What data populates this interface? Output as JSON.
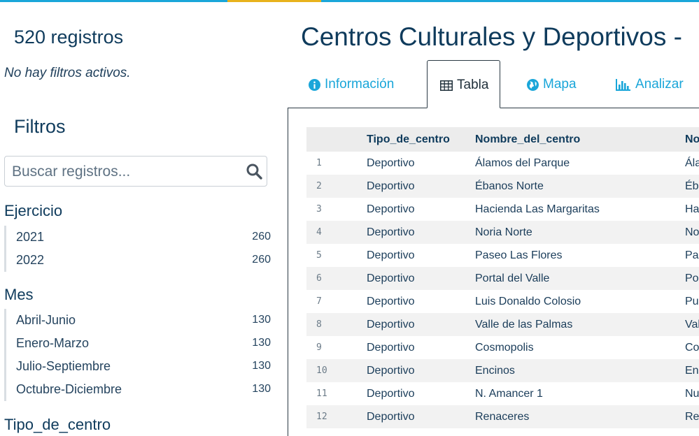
{
  "sidebar": {
    "record_count": "520 registros",
    "no_filters": "No hay filtros activos.",
    "filters_title": "Filtros",
    "search_placeholder": "Buscar registros...",
    "facets": [
      {
        "title": "Ejercicio",
        "items": [
          {
            "label": "2021",
            "count": "260"
          },
          {
            "label": "2022",
            "count": "260"
          }
        ]
      },
      {
        "title": "Mes",
        "items": [
          {
            "label": "Abril-Junio",
            "count": "130"
          },
          {
            "label": "Enero-Marzo",
            "count": "130"
          },
          {
            "label": "Julio-Septiembre",
            "count": "130"
          },
          {
            "label": "Octubre-Diciembre",
            "count": "130"
          }
        ]
      },
      {
        "title": "Tipo_de_centro",
        "items": []
      }
    ]
  },
  "main": {
    "title": "Centros Culturales y Deportivos - ",
    "tabs": [
      {
        "label": "Información",
        "icon": "info-circle-icon"
      },
      {
        "label": "Tabla",
        "icon": "table-icon"
      },
      {
        "label": "Mapa",
        "icon": "globe-icon"
      },
      {
        "label": "Analizar",
        "icon": "bar-chart-icon"
      }
    ],
    "active_tab": "Tabla",
    "table": {
      "headers": [
        "",
        "Tipo_de_centro",
        "Nombre_del_centro",
        "No"
      ],
      "rows": [
        [
          "1",
          "Deportivo",
          "Álamos del Parque",
          "Ála"
        ],
        [
          "2",
          "Deportivo",
          "Ébanos Norte",
          "Éba"
        ],
        [
          "3",
          "Deportivo",
          "Hacienda Las Margaritas",
          "Ha"
        ],
        [
          "4",
          "Deportivo",
          "Noria Norte",
          "No"
        ],
        [
          "5",
          "Deportivo",
          "Paseo Las Flores",
          "Pas"
        ],
        [
          "6",
          "Deportivo",
          "Portal del Valle",
          "Por"
        ],
        [
          "7",
          "Deportivo",
          "Luis Donaldo Colosio",
          "Pue"
        ],
        [
          "8",
          "Deportivo",
          "Valle de las Palmas",
          "Val"
        ],
        [
          "9",
          "Deportivo",
          "Cosmopolis",
          "Co"
        ],
        [
          "10",
          "Deportivo",
          "Encinos",
          "Enc"
        ],
        [
          "11",
          "Deportivo",
          "N. Amancer 1",
          "Nu"
        ],
        [
          "12",
          "Deportivo",
          "Renaceres",
          "Re"
        ]
      ]
    }
  },
  "colors": {
    "accent_blue": "#1aa6d9",
    "accent_yellow": "#e8b21c",
    "title_navy": "#0f3b5c"
  }
}
